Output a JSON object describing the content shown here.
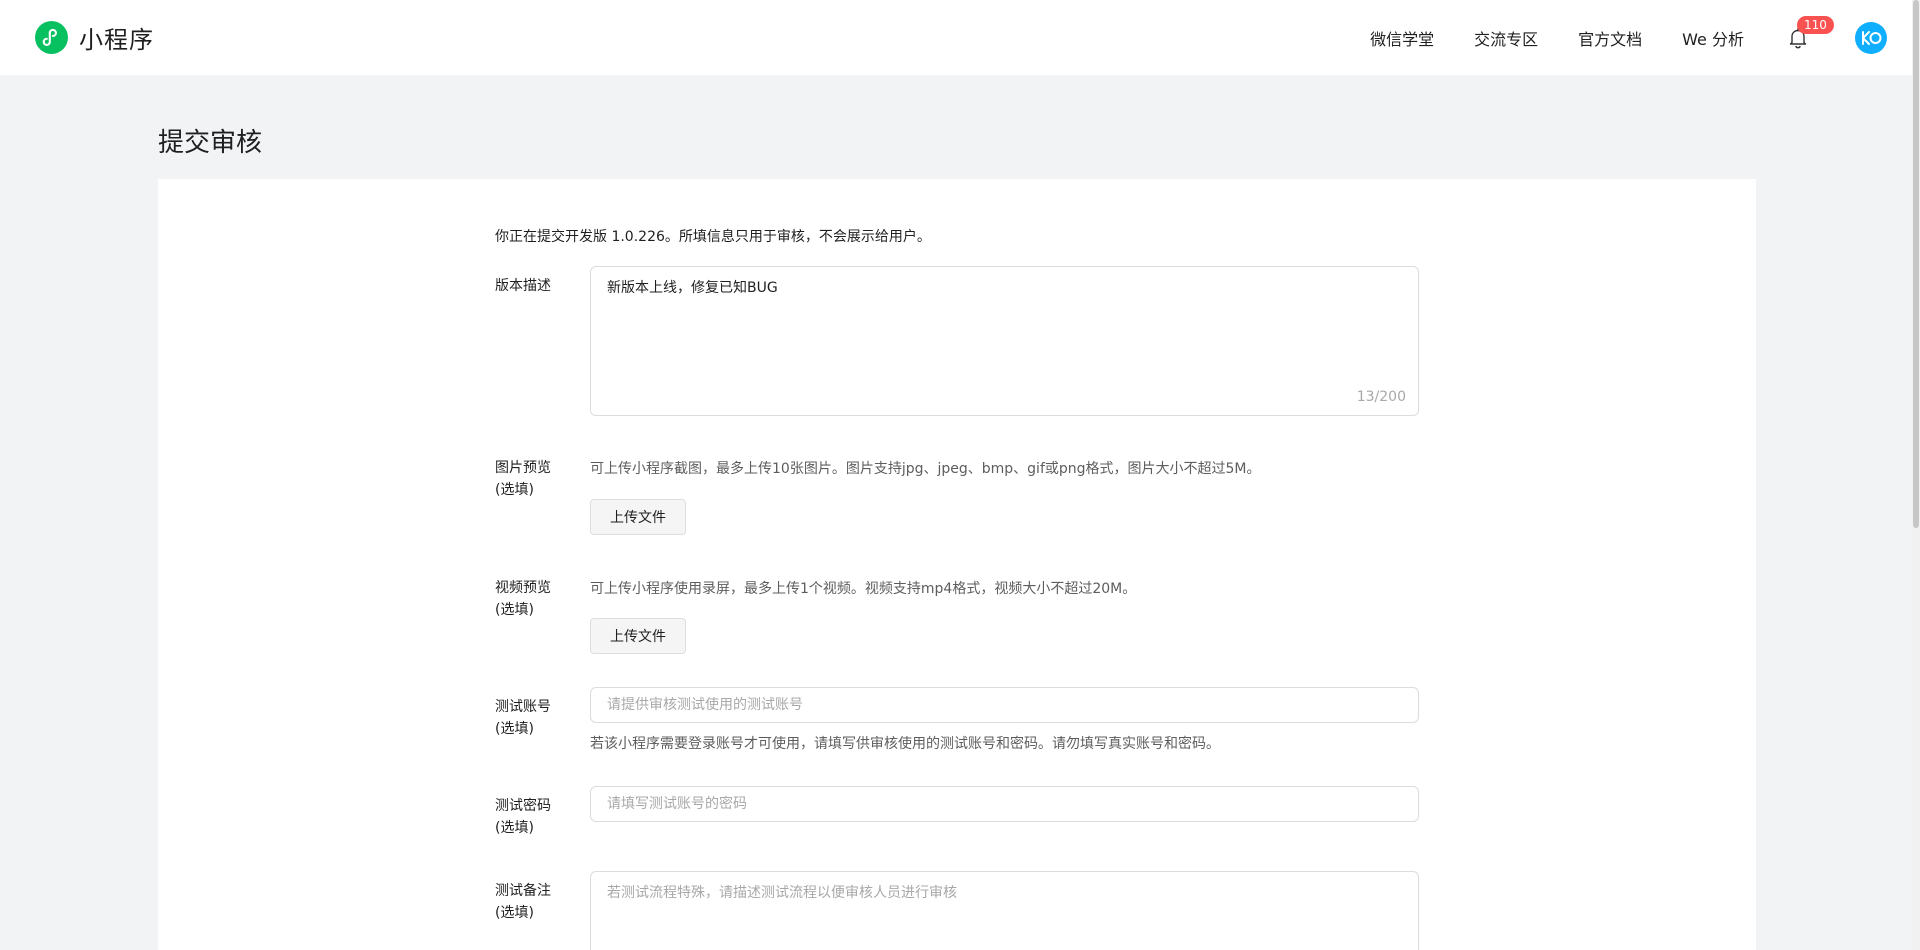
{
  "header": {
    "logo_text": "小程序",
    "nav": [
      "微信学堂",
      "交流专区",
      "官方文档",
      "We 分析"
    ],
    "notification_count": "110",
    "logo_icon": "miniprogram-logo-icon",
    "bell_icon": "bell-icon",
    "avatar_icon": "avatar-icon",
    "brand_color": "#07c160",
    "badge_color": "#fa5151",
    "avatar_color": "#10aeff"
  },
  "page": {
    "title": "提交审核",
    "intro": "你正在提交开发版 1.0.226。所填信息只用于审核，不会展示给用户。"
  },
  "form": {
    "version_desc": {
      "label": "版本描述",
      "value": "新版本上线，修复已知BUG",
      "counter": "13/200"
    },
    "image_preview": {
      "label": "图片预览",
      "optional": "(选填)",
      "hint": "可上传小程序截图，最多上传10张图片。图片支持jpg、jpeg、bmp、gif或png格式，图片大小不超过5M。",
      "button": "上传文件"
    },
    "video_preview": {
      "label": "视频预览",
      "optional": "(选填)",
      "hint": "可上传小程序使用录屏，最多上传1个视频。视频支持mp4格式，视频大小不超过20M。",
      "button": "上传文件"
    },
    "test_account": {
      "label": "测试账号",
      "optional": "(选填)",
      "placeholder": "请提供审核测试使用的测试账号",
      "hint": "若该小程序需要登录账号才可使用，请填写供审核使用的测试账号和密码。请勿填写真实账号和密码。"
    },
    "test_password": {
      "label": "测试密码",
      "optional": "(选填)",
      "placeholder": "请填写测试账号的密码"
    },
    "test_note": {
      "label": "测试备注",
      "optional": "(选填)",
      "placeholder": "若测试流程特殊，请描述测试流程以便审核人员进行审核"
    }
  }
}
